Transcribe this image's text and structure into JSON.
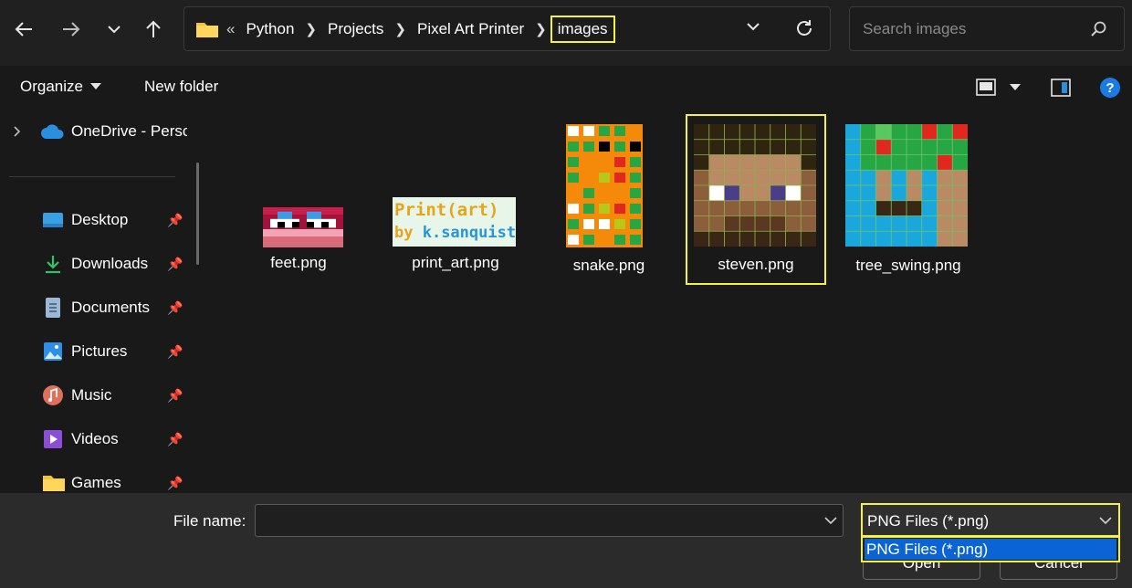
{
  "address": {
    "overflow": "«",
    "crumbs": [
      "Python",
      "Projects",
      "Pixel Art Printer",
      "images"
    ]
  },
  "search": {
    "placeholder": "Search images"
  },
  "toolbar": {
    "organize": "Organize",
    "new_folder": "New folder"
  },
  "sidebar": {
    "onedrive": "OneDrive - Perso",
    "items": [
      "Desktop",
      "Downloads",
      "Documents",
      "Pictures",
      "Music",
      "Videos",
      "Games"
    ]
  },
  "files": [
    "feet.png",
    "print_art.png",
    "snake.png",
    "steven.png",
    "tree_swing.png"
  ],
  "print_art_thumb": {
    "line1": "Print(art)",
    "line2_prefix": "by ",
    "line2_name": "k.sanquist"
  },
  "bottom": {
    "file_name_label": "File name:",
    "file_name_value": "",
    "file_type_selected": "PNG Files (*.png)",
    "file_type_option": "PNG Files (*.png)",
    "open": "Open",
    "cancel": "Cancel"
  },
  "colors": {
    "highlight": "#f5f23c",
    "accent": "#0a64d6",
    "onedrive": "#2b8fe0"
  }
}
